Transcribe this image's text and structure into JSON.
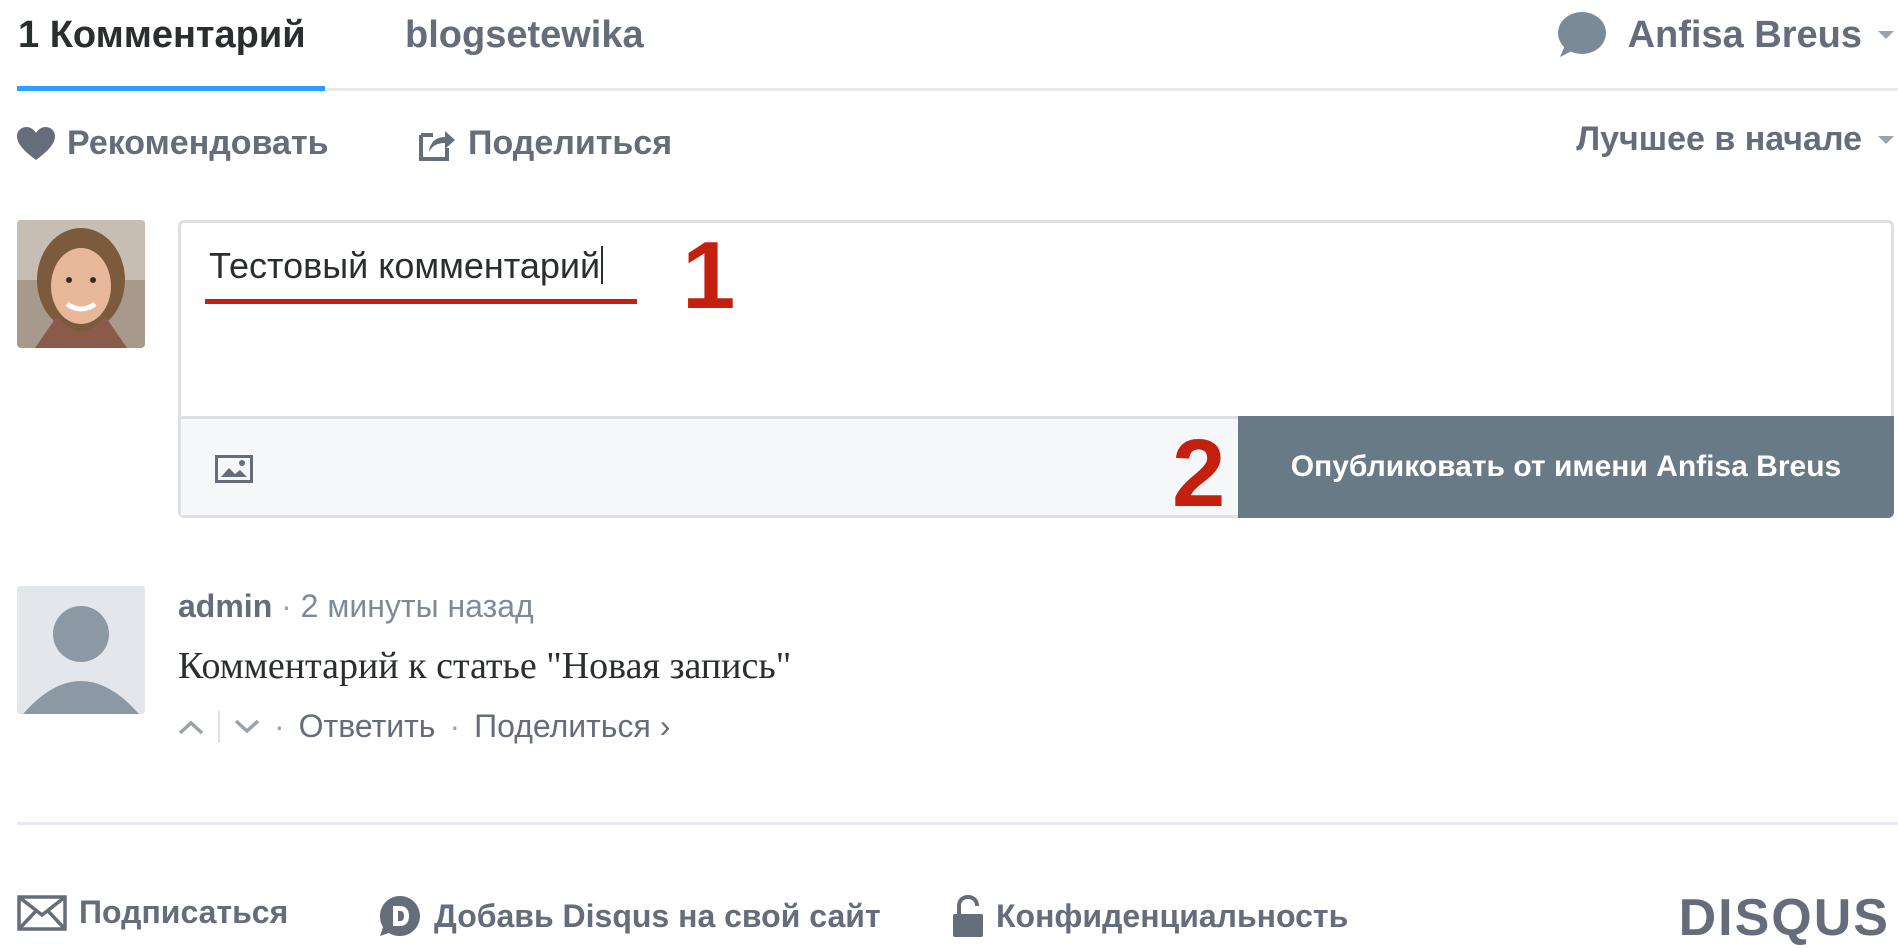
{
  "tabs": {
    "comments_tab": "1 Комментарий",
    "forum_tab": "blogsetewika"
  },
  "user": {
    "name": "Anfisa Breus"
  },
  "actions": {
    "recommend": "Рекомендовать",
    "share": "Поделиться",
    "sort": "Лучшее в начале"
  },
  "composer": {
    "text": "Тестовый комментарий",
    "publish_button": "Опубликовать от имени Anfisa Breus"
  },
  "annotations": {
    "step1": "1",
    "step2": "2"
  },
  "comment": {
    "author": "admin",
    "separator": "·",
    "time": "2 минуты назад",
    "body": "Комментарий к статье \"Новая запись\"",
    "reply": "Ответить",
    "share": "Поделиться ›"
  },
  "footer": {
    "subscribe": "Подписаться",
    "add_disqus": "Добавь Disqus на свой сайт",
    "privacy": "Конфиденциальность",
    "logo": "DISQUS"
  },
  "colors": {
    "accent_blue": "#2e9fff",
    "publish_button": "#687a86",
    "annotation_red": "#c4200f",
    "muted_text": "#656c7a"
  },
  "icons": [
    "chat-bubble-icon",
    "heart-icon",
    "share-icon",
    "image-icon",
    "upvote-icon",
    "downvote-icon",
    "envelope-icon",
    "disqus-d-icon",
    "lock-icon"
  ]
}
